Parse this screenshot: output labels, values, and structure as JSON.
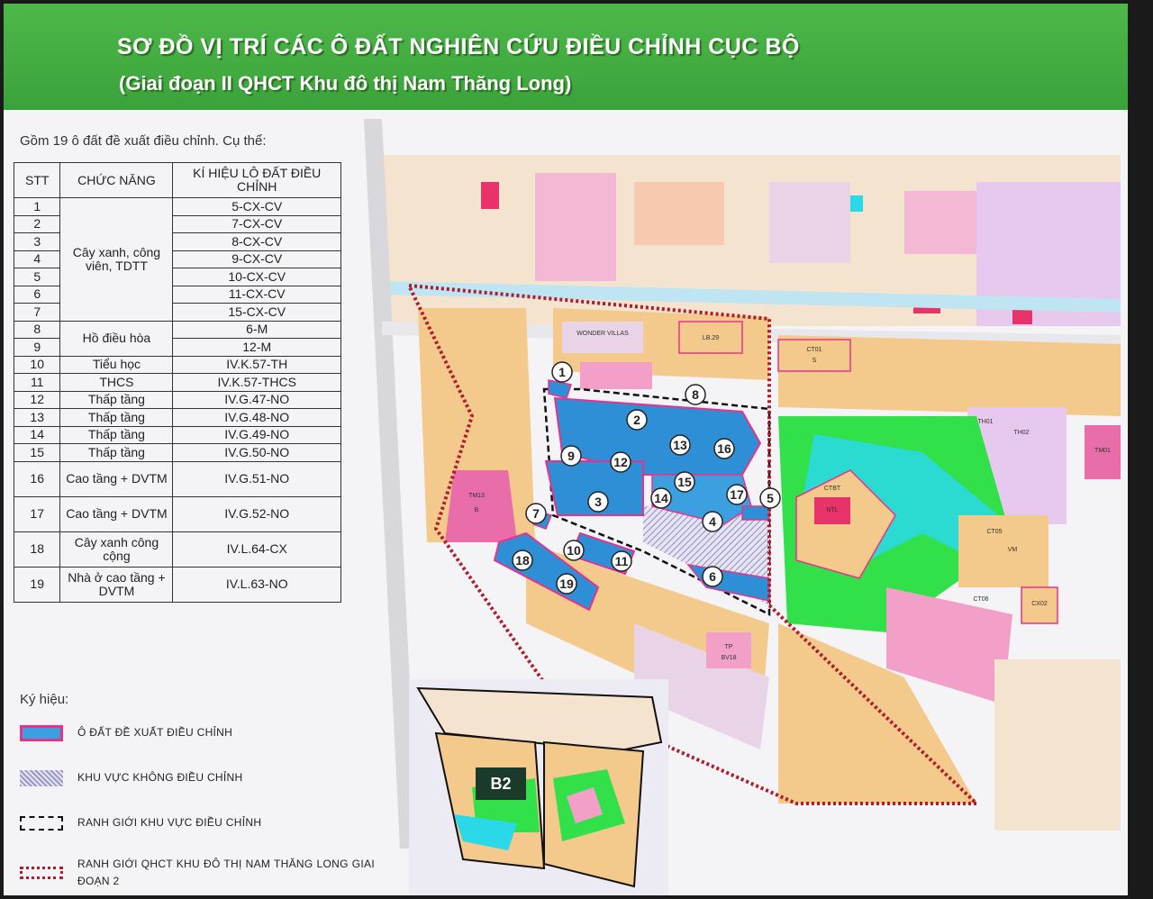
{
  "header": {
    "title": "SƠ ĐỒ VỊ TRÍ CÁC Ô ĐẤT NGHIÊN CỨU ĐIỀU CHỈNH CỤC BỘ",
    "subtitle": "(Giai đoạn II QHCT Khu đô thị Nam Thăng Long)"
  },
  "intro": "Gồm 19 ô đất đề xuất điều chỉnh. Cụ thể:",
  "table": {
    "headers": [
      "STT",
      "CHỨC NĂNG",
      "KÍ HIỆU LÔ ĐẤT ĐIỀU CHỈNH"
    ],
    "groups": {
      "g1": "Cây xanh, công viên, TDTT",
      "g2": "Hồ điều hòa",
      "g3": "Tiểu học",
      "g4": "THCS",
      "g5": "Thấp tầng",
      "g6": "Thấp tầng",
      "g7": "Thấp tầng",
      "g8": "Thấp tầng",
      "g9": "Cao tầng + DVTM",
      "g10": "Cao tầng + DVTM",
      "g11": "Cây xanh công cộng",
      "g12": "Nhà ở cao tầng + DVTM"
    },
    "rows": [
      {
        "stt": "1",
        "code": "5-CX-CV"
      },
      {
        "stt": "2",
        "code": "7-CX-CV"
      },
      {
        "stt": "3",
        "code": "8-CX-CV"
      },
      {
        "stt": "4",
        "code": "9-CX-CV"
      },
      {
        "stt": "5",
        "code": "10-CX-CV"
      },
      {
        "stt": "6",
        "code": "11-CX-CV"
      },
      {
        "stt": "7",
        "code": "15-CX-CV"
      },
      {
        "stt": "8",
        "code": "6-M"
      },
      {
        "stt": "9",
        "code": "12-M"
      },
      {
        "stt": "10",
        "code": "IV.K.57-TH"
      },
      {
        "stt": "11",
        "code": "IV.K.57-THCS"
      },
      {
        "stt": "12",
        "code": "IV.G.47-NO"
      },
      {
        "stt": "13",
        "code": "IV.G.48-NO"
      },
      {
        "stt": "14",
        "code": "IV.G.49-NO"
      },
      {
        "stt": "15",
        "code": "IV.G.50-NO"
      },
      {
        "stt": "16",
        "code": "IV.G.51-NO"
      },
      {
        "stt": "17",
        "code": "IV.G.52-NO"
      },
      {
        "stt": "18",
        "code": "IV.L.64-CX"
      },
      {
        "stt": "19",
        "code": "IV.L.63-NO"
      }
    ]
  },
  "legend": {
    "title": "Ký hiệu:",
    "items": [
      "Ô ĐẤT ĐỀ XUẤT ĐIỀU CHỈNH",
      "KHU VỰC KHÔNG ĐIỀU CHỈNH",
      "RANH GIỚI KHU VỰC ĐIỀU CHỈNH",
      "RANH GIỚI QHCT KHU ĐÔ THỊ NAM THĂNG LONG GIAI ĐOẠN 2"
    ]
  },
  "map": {
    "parcel_numbers": [
      "1",
      "2",
      "3",
      "4",
      "5",
      "6",
      "7",
      "8",
      "9",
      "10",
      "11",
      "12",
      "13",
      "14",
      "15",
      "15",
      "16",
      "17",
      "18",
      "19"
    ],
    "labels": {
      "tm13": "TM13",
      "b": "B",
      "ct01": "CT01",
      "s": "S",
      "lb29": "LB.29",
      "ctbt": "CTBT",
      "ntl": "NTL",
      "ct05": "CT05",
      "vm": "VM",
      "ct06": "CT06",
      "cx02": "CX02",
      "tp": "TP",
      "bv18": "BV18",
      "wonder": "WONDER VILLAS",
      "th01": "TH01",
      "th02": "TH02",
      "tm01": "TM01"
    },
    "inset_label": "B2"
  },
  "colors": {
    "header": "#3aa23a",
    "adjust_parcel": "#3b9fe0",
    "parcel_border": "#e8328a",
    "park": "#32e04a",
    "boundary2": "#b01c2c"
  }
}
